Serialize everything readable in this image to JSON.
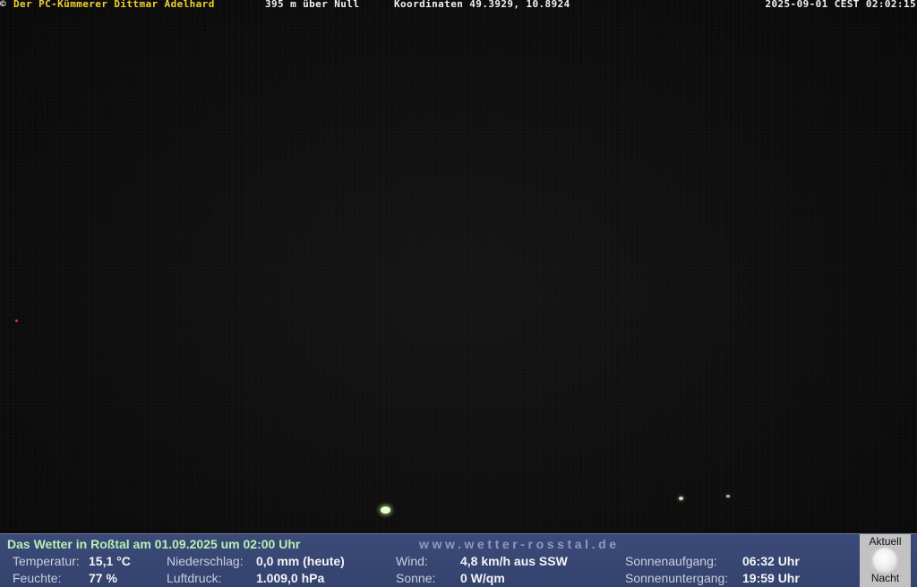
{
  "top_bar": {
    "copyright": "©",
    "operator": "Der PC-Kümmerer Dittmar Adelhard",
    "altitude": "395 m über Null",
    "coordinates": "Koordinaten 49.3929, 10.8924",
    "timestamp": "2025-09-01 CEST 02:02:15"
  },
  "panel": {
    "title": "Das Wetter in Roßtal am 01.09.2025 um 02:00 Uhr",
    "url": "www.wetter-rosstal.de",
    "temperature": {
      "label": "Temperatur:",
      "value": "15,1 °C"
    },
    "humidity": {
      "label": "Feuchte:",
      "value": "77 %"
    },
    "precipitation": {
      "label": "Niederschlag:",
      "value": "0,0 mm (heute)"
    },
    "pressure": {
      "label": "Luftdruck:",
      "value": "1.009,0 hPa"
    },
    "wind": {
      "label": "Wind:",
      "value": "4,8 km/h aus SSW"
    },
    "sun": {
      "label": "Sonne:",
      "value": "0 W/qm"
    },
    "sunrise": {
      "label": "Sonnenaufgang:",
      "value": "06:32 Uhr"
    },
    "sunset": {
      "label": "Sonnenuntergang:",
      "value": "19:59 Uhr"
    }
  },
  "moon": {
    "top_label": "Aktuell",
    "bottom_label": "Nacht",
    "icon": "full-moon-icon"
  },
  "colors": {
    "panel_background": "#3c4a78",
    "title_green": "#b6f0b1",
    "operator_yellow": "#f1d22f"
  }
}
